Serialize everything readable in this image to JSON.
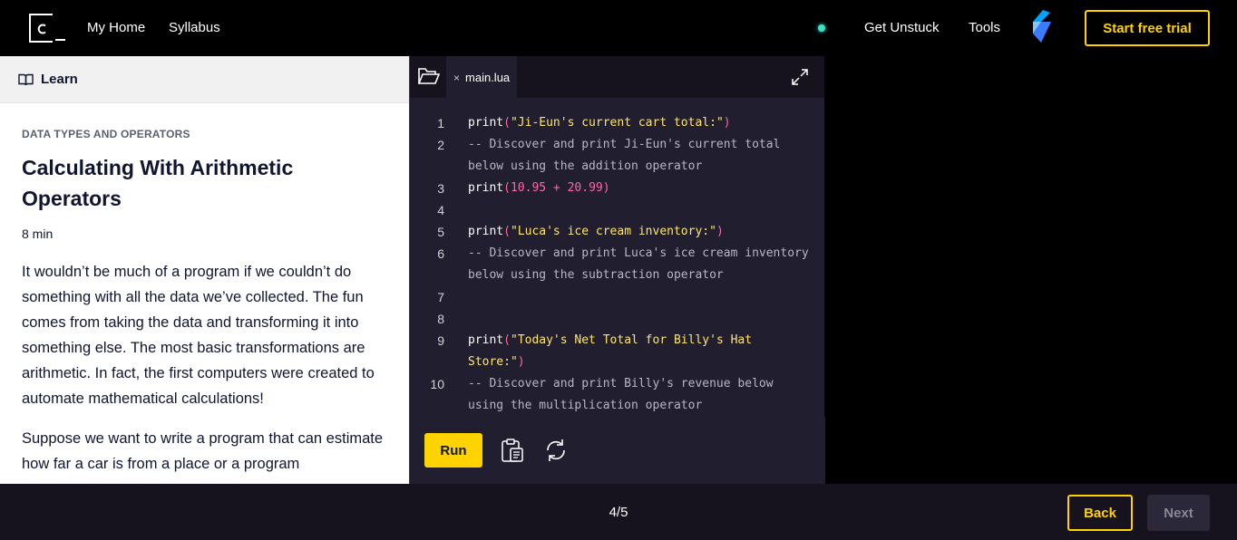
{
  "nav": {
    "links": [
      "My Home",
      "Syllabus"
    ],
    "right_links": [
      "Get Unstuck",
      "Tools"
    ],
    "trial_label": "Start free trial",
    "status_color": "#3de2c4",
    "accent": "#ffd300"
  },
  "learn": {
    "header": "Learn",
    "kicker": "DATA TYPES AND OPERATORS",
    "title": "Calculating With Arithmetic Operators",
    "duration": "8 min",
    "paragraphs": [
      "It wouldn’t be much of a program if we couldn’t do something with all the data we’ve collected. The fun comes from taking the data and transforming it into something else. The most basic transformations are arithmetic. In fact, the first computers were created to automate mathematical calculations!",
      "Suppose we want to write a program that can estimate how far a car is from a place or a program"
    ]
  },
  "editor": {
    "tab_name": "main.lua",
    "close_glyph": "×",
    "run_label": "Run",
    "lines": [
      {
        "n": "1",
        "tokens": [
          {
            "t": "print",
            "k": "fn"
          },
          {
            "t": "(",
            "k": "p"
          },
          {
            "t": "\"Ji-Eun's current cart total:\"",
            "k": "s"
          },
          {
            "t": ")",
            "k": "p"
          }
        ]
      },
      {
        "n": "2",
        "tokens": [
          {
            "t": "-- Discover and print Ji-Eun's current total below using the addition operator",
            "k": "c"
          }
        ]
      },
      {
        "n": "3",
        "tokens": [
          {
            "t": "print",
            "k": "fn"
          },
          {
            "t": "(",
            "k": "p"
          },
          {
            "t": "10.95",
            "k": "n"
          },
          {
            "t": " + ",
            "k": "p"
          },
          {
            "t": "20.99",
            "k": "n"
          },
          {
            "t": ")",
            "k": "p"
          }
        ]
      },
      {
        "n": "4",
        "tokens": []
      },
      {
        "n": "5",
        "tokens": [
          {
            "t": "print",
            "k": "fn"
          },
          {
            "t": "(",
            "k": "p"
          },
          {
            "t": "\"Luca's ice cream inventory:\"",
            "k": "s"
          },
          {
            "t": ")",
            "k": "p"
          }
        ]
      },
      {
        "n": "6",
        "tokens": [
          {
            "t": "-- Discover and print Luca's ice cream inventory below using the subtraction operator",
            "k": "c"
          }
        ]
      },
      {
        "n": "7",
        "tokens": []
      },
      {
        "n": "8",
        "tokens": []
      },
      {
        "n": "9",
        "tokens": [
          {
            "t": "print",
            "k": "fn"
          },
          {
            "t": "(",
            "k": "p"
          },
          {
            "t": "\"Today's Net Total for Billy's Hat Store:\"",
            "k": "s"
          },
          {
            "t": ")",
            "k": "p"
          }
        ]
      },
      {
        "n": "10",
        "tokens": [
          {
            "t": "-- Discover and print Billy's revenue below using the multiplication operator",
            "k": "c"
          }
        ]
      }
    ]
  },
  "footer": {
    "progress": "4/5",
    "back_label": "Back",
    "next_label": "Next"
  }
}
